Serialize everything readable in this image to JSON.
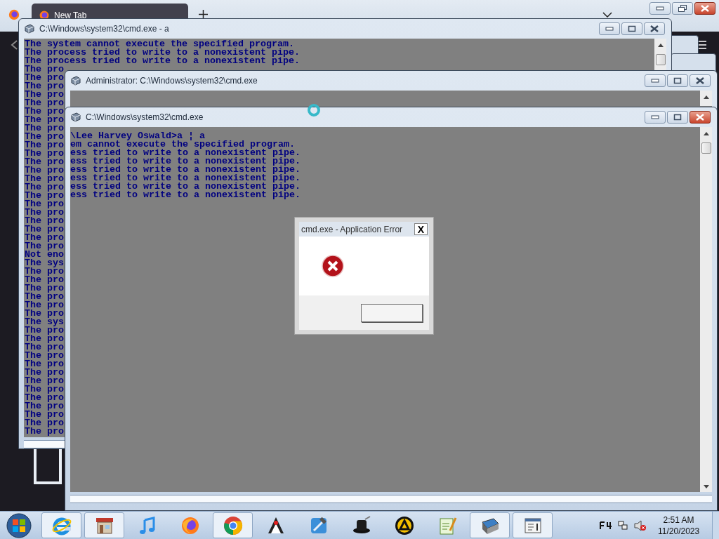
{
  "browser": {
    "tab": "New Tab"
  },
  "windows": [
    {
      "title": "C:\\Windows\\system32\\cmd.exe - a",
      "active": false,
      "lines": [
        "The system cannot execute the specified program.",
        "The process tried to write to a nonexistent pipe.",
        "The process tried to write to a nonexistent pipe.",
        "The pro",
        "The pro",
        "The pro",
        "The pro",
        "The pro",
        "The pro",
        "The pro",
        "The pro",
        "The pro",
        "The pro",
        "The pro",
        "The pro",
        "The pro",
        "The pro",
        "The pro",
        "The pro",
        "The pro",
        "The pro",
        "The pro",
        "The pro",
        "The pro",
        "The pro",
        "Not eno",
        "The sys",
        "The pro",
        "The pro",
        "The pro",
        "The pro",
        "The pro",
        "The pro",
        "The sys",
        "The pro",
        "The pro",
        "The pro",
        "The pro",
        "The pro",
        "The pro",
        "The pro",
        "The pro",
        "The pro",
        "The pro",
        "The pro",
        "The pro",
        "The pro"
      ]
    },
    {
      "title": "Administrator: C:\\Windows\\system32\\cmd.exe",
      "active": false
    },
    {
      "title": "C:\\Windows\\system32\\cmd.exe",
      "active": true,
      "lines": [
        "\\Lee Harvey Oswald>a ¦ a",
        "em cannot execute the specified program.",
        "ess tried to write to a nonexistent pipe.",
        "ess tried to write to a nonexistent pipe.",
        "ess tried to write to a nonexistent pipe.",
        "ess tried to write to a nonexistent pipe.",
        "ess tried to write to a nonexistent pipe.",
        "ess tried to write to a nonexistent pipe."
      ]
    }
  ],
  "dialog": {
    "title": "cmd.exe - Application Error",
    "close": "X"
  },
  "taskbar": {
    "items": [
      {
        "kind": "ie",
        "running": true
      },
      {
        "kind": "store",
        "running": true
      },
      {
        "kind": "music",
        "running": false
      },
      {
        "kind": "firefox",
        "running": false
      },
      {
        "kind": "chrome",
        "running": true
      },
      {
        "kind": "java",
        "running": false
      },
      {
        "kind": "xcode",
        "running": false
      },
      {
        "kind": "hat",
        "running": false
      },
      {
        "kind": "aimp",
        "running": false
      },
      {
        "kind": "notepad",
        "running": false
      },
      {
        "kind": "window",
        "running": true
      },
      {
        "kind": "console",
        "running": true
      }
    ],
    "time": "2:51 AM",
    "date": "11/20/2023"
  }
}
